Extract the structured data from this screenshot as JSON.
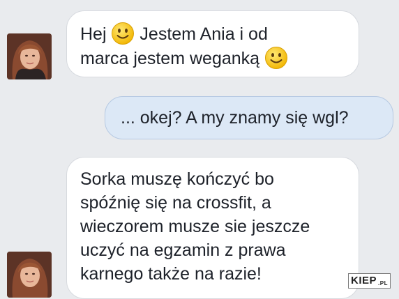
{
  "messages": [
    {
      "side": "incoming",
      "line1_a": "Hej ",
      "line1_b": " Jestem Ania i od",
      "line2": "marca jestem weganką ",
      "emoji": "slightly-smiling-face-icon"
    },
    {
      "side": "outgoing",
      "text": "... okej? A my znamy się wgl?"
    },
    {
      "side": "incoming",
      "lines": [
        "Sorka muszę kończyć bo",
        "spóźnię się na crossfit, a",
        "wieczorem musze sie jeszcze",
        "uczyć na egzamin z prawa",
        "karnego także na razie!"
      ]
    }
  ],
  "watermark": {
    "main": "KIEP",
    "sub": ".PL"
  },
  "colors": {
    "background": "#e9ebee",
    "incoming_bubble": "#ffffff",
    "outgoing_bubble": "#dce8f6",
    "text": "#1d2129",
    "emoji": "#f7cd2e"
  }
}
